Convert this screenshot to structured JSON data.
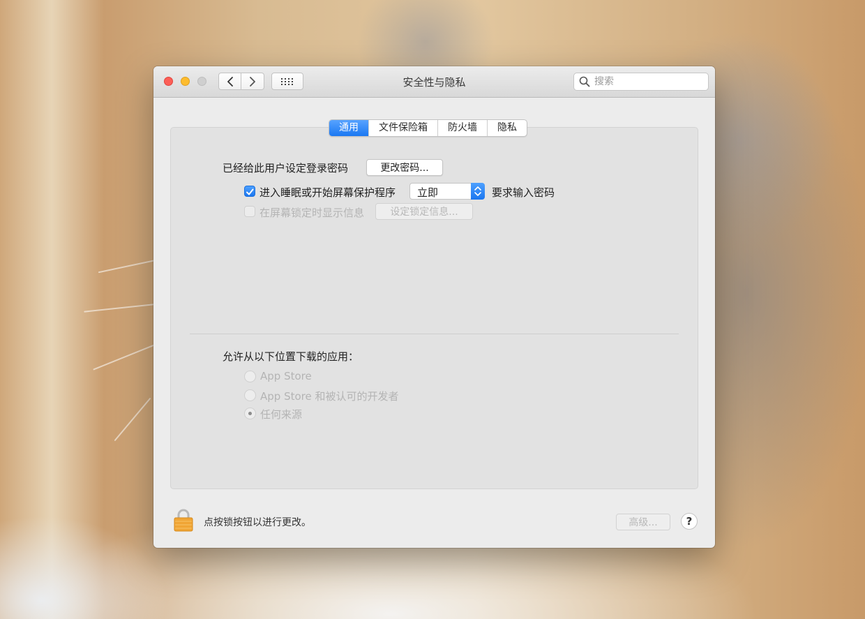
{
  "window": {
    "title": "安全性与隐私",
    "search_placeholder": "搜索"
  },
  "tabs": [
    {
      "label": "通用",
      "active": true
    },
    {
      "label": "文件保险箱",
      "active": false
    },
    {
      "label": "防火墙",
      "active": false
    },
    {
      "label": "隐私",
      "active": false
    }
  ],
  "general": {
    "password_set_label": "已经给此用户设定登录密码",
    "change_password_button": "更改密码...",
    "require_password": {
      "checked": true,
      "label": "进入睡眠或开始屏幕保护程序",
      "delay_value": "立即",
      "suffix": "要求输入密码"
    },
    "show_message": {
      "checked": false,
      "label": "在屏幕锁定时显示信息",
      "button": "设定锁定信息..."
    }
  },
  "downloads": {
    "label": "允许从以下位置下载的应用：",
    "options": [
      {
        "label": "App Store",
        "selected": false
      },
      {
        "label": "App Store 和被认可的开发者",
        "selected": false
      },
      {
        "label": "任何来源",
        "selected": true
      }
    ]
  },
  "footer": {
    "lock_text": "点按锁按钮以进行更改。",
    "advanced_button": "高级...",
    "help_button": "?"
  },
  "colors": {
    "accent": "#1b76ef",
    "close": "#fc5f57",
    "minimize": "#fdbc2e",
    "lock": "#f0a535"
  }
}
